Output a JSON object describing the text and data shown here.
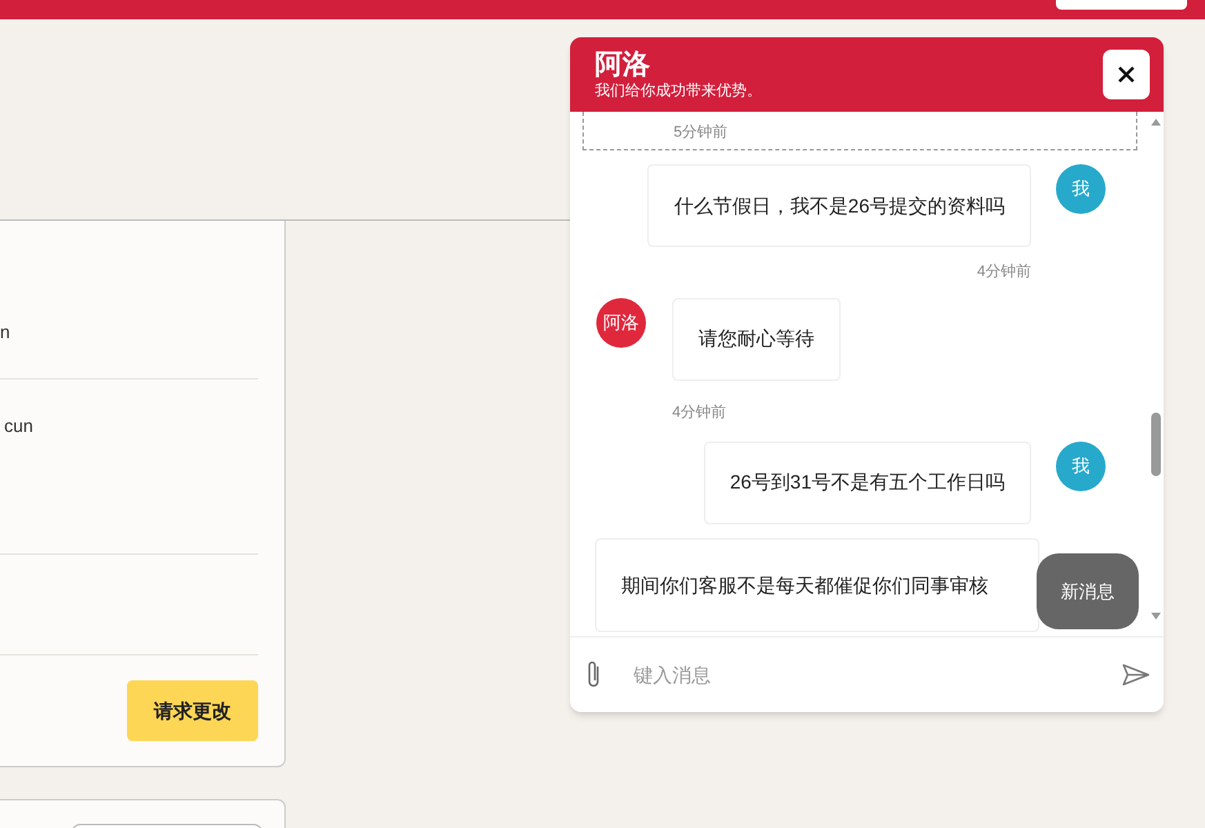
{
  "left_panel": {
    "rows": [
      {
        "text": "n"
      },
      {
        "text": "cun"
      }
    ],
    "button": "请求更改"
  },
  "chat": {
    "title": "阿洛",
    "subtitle": "我们给你成功带来优势。",
    "messages": [
      {
        "kind": "cut",
        "time": "5分钟前"
      },
      {
        "kind": "user",
        "avatar": "我",
        "text": "什么节假日，我不是26号提交的资料吗",
        "time": "4分钟前"
      },
      {
        "kind": "agent",
        "avatar": "阿洛",
        "text": "请您耐心等待",
        "time": "4分钟前"
      },
      {
        "kind": "user",
        "avatar": "我",
        "text": "26号到31号不是有五个工作日吗"
      },
      {
        "kind": "long",
        "text": "期间你们客服不是每天都催促你们同事审核"
      }
    ],
    "new_badge": "新消息",
    "input": {
      "placeholder": "键入消息"
    }
  }
}
